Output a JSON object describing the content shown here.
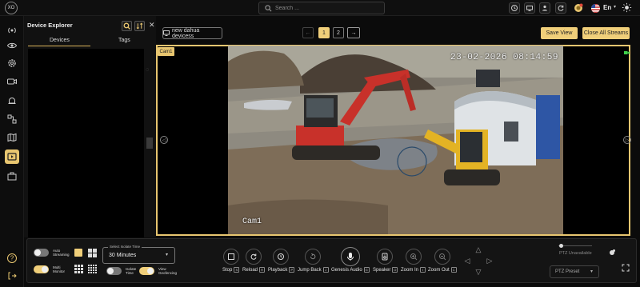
{
  "topbar": {
    "search_placeholder": "Search ...",
    "language": "En",
    "icons": [
      "clock-icon",
      "monitor-icon",
      "user-icon",
      "refresh-icon",
      "notification-icon",
      "flag-us-icon",
      "sun-icon"
    ]
  },
  "sidebar": {
    "icons": [
      "broadcast-icon",
      "eye-icon",
      "settings-icon",
      "video-icon",
      "alert-icon",
      "network-icon",
      "map-icon",
      "streams-icon",
      "briefcase-icon",
      "help-icon",
      "logout-icon"
    ],
    "active": "streams-icon"
  },
  "explorer": {
    "title": "Device Explorer",
    "tabs": [
      "Devices",
      "Tags"
    ],
    "active_tab": "Devices"
  },
  "stream_toolbar": {
    "layout_name": "new dahua devicess",
    "pages": [
      "1",
      "2"
    ],
    "active_page": "1",
    "save_view": "Save View",
    "close_all": "Close All Streams"
  },
  "stream": {
    "cam_label": "Cam1",
    "timestamp": "23-02-2026 08:14:59",
    "overlay_name": "Cam1"
  },
  "bottom": {
    "auto_streaming_label": "Auto Streaming",
    "multi_monitor_label": "Multi Monitor",
    "isolate_time_label": "Isolate Time",
    "view_geofencing_label": "View Geofencing",
    "select_isolate_time_legend": "Select Isolate Time",
    "isolate_time_value": "30 Minutes",
    "controls": [
      {
        "label": "Stop",
        "key": "S"
      },
      {
        "label": "Reload",
        "key": "R"
      },
      {
        "label": "Playback",
        "key": "P"
      },
      {
        "label": "Jump Back",
        "key": "J"
      },
      {
        "label": "Genesis Audio",
        "key": "G"
      },
      {
        "label": "Speaker",
        "key": "O"
      },
      {
        "label": "Zoom In",
        "key": "I"
      },
      {
        "label": "Zoom Out",
        "key": "C"
      }
    ],
    "ptz_status": "PTZ Unavailable",
    "ptz_preset_placeholder": "PTZ Preset",
    "auto_streaming_on": false,
    "multi_monitor_on": true,
    "isolate_time_on": false,
    "view_geofencing_on": true
  },
  "colors": {
    "accent": "#e8c670",
    "background": "#0b0b0b",
    "panel": "#141414"
  }
}
